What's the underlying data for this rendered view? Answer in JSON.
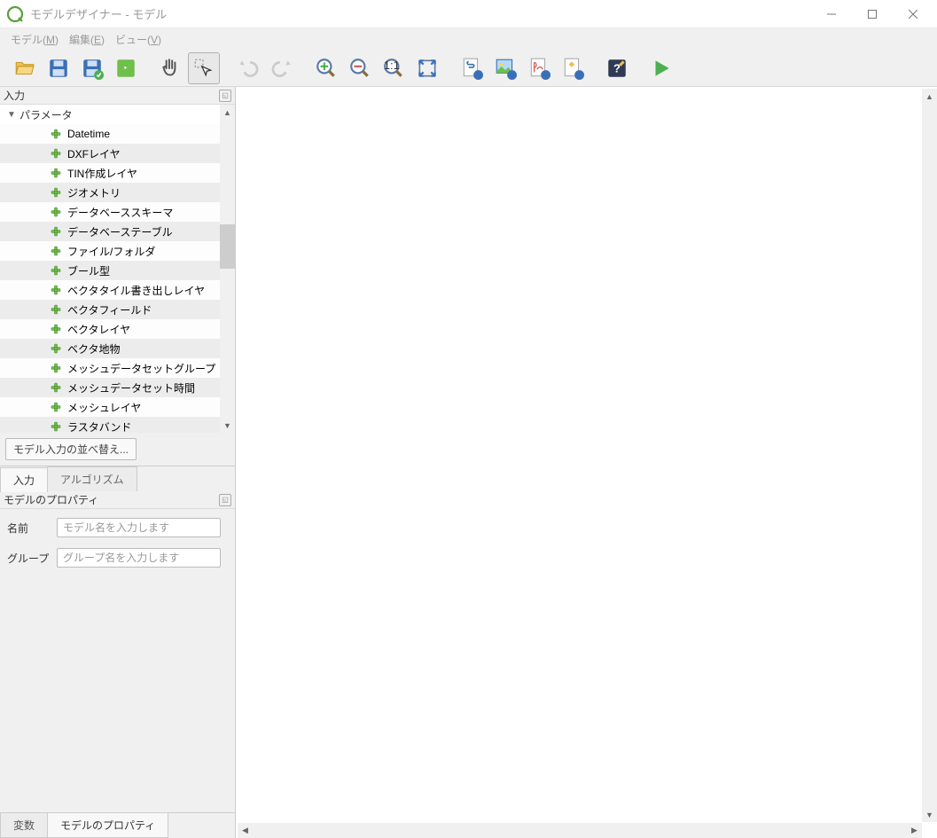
{
  "window": {
    "title": "モデルデザイナー - モデル"
  },
  "menu": {
    "model": "モデル(M)",
    "edit": "編集(E)",
    "view": "ビュー(V)"
  },
  "toolbar": {
    "open": "open",
    "save": "save",
    "saveInProject": "save-in-project",
    "validate": "validate",
    "pan": "pan",
    "select": "select",
    "undo": "undo",
    "redo": "redo",
    "zoomIn": "zoom-in",
    "zoomOut": "zoom-out",
    "zoom100": "zoom-1-1",
    "zoomFull": "zoom-full",
    "exportPy": "export-python",
    "exportImg": "export-image",
    "exportPdf": "export-pdf",
    "exportSvg": "export-svg",
    "help": "help",
    "run": "run"
  },
  "inputs": {
    "panel_title": "入力",
    "group_label": "パラメータ",
    "items": [
      "Datetime",
      "DXFレイヤ",
      "TIN作成レイヤ",
      "ジオメトリ",
      "データベーススキーマ",
      "データベーステーブル",
      "ファイル/フォルダ",
      "ブール型",
      "ベクタタイル書き出しレイヤ",
      "ベクタフィールド",
      "ベクタレイヤ",
      "ベクタ地物",
      "メッシュデータセットグループ",
      "メッシュデータセット時間",
      "メッシュレイヤ",
      "ラスタバンド"
    ],
    "reorder_label": "モデル入力の並べ替え...",
    "tab_inputs": "入力",
    "tab_algorithms": "アルゴリズム"
  },
  "properties": {
    "panel_title": "モデルのプロパティ",
    "name_label": "名前",
    "name_placeholder": "モデル名を入力します",
    "group_label": "グループ",
    "group_placeholder": "グループ名を入力します"
  },
  "bottom_tabs": {
    "variables": "変数",
    "properties": "モデルのプロパティ"
  }
}
